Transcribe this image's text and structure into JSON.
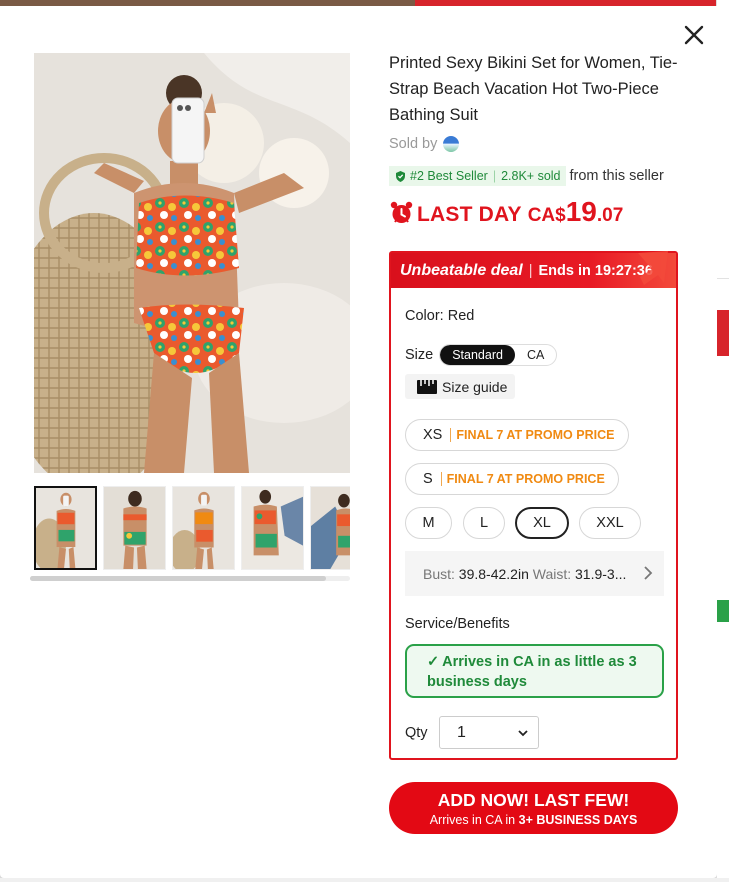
{
  "product": {
    "title": "Printed Sexy Bikini Set for Women, Tie-Strap Beach Vacation Hot Two-Piece Bathing Suit",
    "sold_by_label": "Sold by",
    "best_seller_rank": "#2 Best Seller",
    "sold_count": "2.8K+ sold",
    "from_seller": "from this seller"
  },
  "price": {
    "label": "LAST DAY",
    "currency": "CA$",
    "integer": "19",
    "decimal": ".07"
  },
  "deal": {
    "name": "Unbeatable deal",
    "ends_label": "Ends in",
    "countdown": "19:27:36"
  },
  "color": {
    "label": "Color:",
    "value": "Red"
  },
  "size": {
    "label": "Size",
    "systems": [
      "Standard",
      "CA"
    ],
    "selected_system": "Standard",
    "guide_label": "Size guide",
    "promo_text": "FINAL 7 AT PROMO PRICE",
    "options": [
      "XS",
      "S",
      "M",
      "L",
      "XL",
      "XXL"
    ],
    "selected": "XL",
    "measurement": {
      "bust_label": "Bust:",
      "bust_value": "39.8-42.2in",
      "waist_label": "Waist:",
      "waist_value": "31.9-3..."
    }
  },
  "service": {
    "label": "Service/Benefits",
    "arrives_text": "Arrives in CA in as little as 3 business days"
  },
  "qty": {
    "label": "Qty",
    "value": "1"
  },
  "cta": {
    "main": "ADD NOW! LAST FEW!",
    "sub_prefix": "Arrives in CA in",
    "sub_bold": "3+ BUSINESS DAYS"
  },
  "gallery": {
    "thumbnail_count": 5,
    "active_index": 0
  },
  "colors": {
    "accent_red": "#e0141e",
    "success_green": "#2aa148",
    "promo_orange": "#f08a12"
  },
  "icons": [
    "close-icon",
    "alarm-clock-icon",
    "best-seller-icon",
    "ruler-icon",
    "chevron-right-icon",
    "checkmark-icon",
    "chevron-down-icon"
  ]
}
